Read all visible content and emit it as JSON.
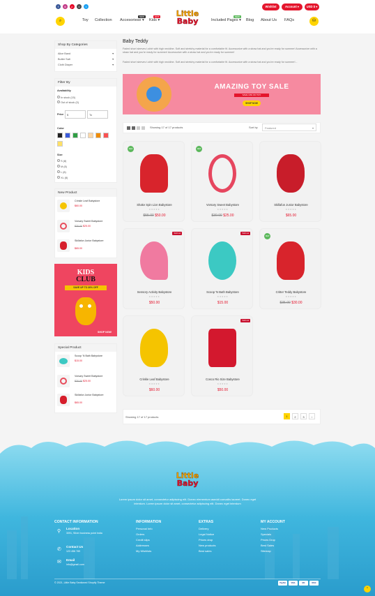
{
  "header": {
    "wishlist": "Wishlist",
    "account": "Account",
    "currency": "USD $",
    "nav": [
      "Toy",
      "Collection",
      "Accesoriese",
      "Kids",
      "Included Pages",
      "Blog",
      "About Us",
      "FAQs"
    ],
    "nav_badges": {
      "accessories": "NEW",
      "kids": "HOT",
      "pages": "NEW"
    },
    "logo_line1": "Little",
    "logo_line2": "Baby"
  },
  "sidebar": {
    "categories_title": "Shop By Categories",
    "categories": [
      "Alice Band",
      "Butter Salt",
      "Cloth Diaper"
    ],
    "filter_title": "Filter By",
    "availability_title": "Availability",
    "availability": [
      "In stock (15)",
      "Out of stock (0)"
    ],
    "price_title": "Price",
    "price_from": "$",
    "price_to": "To",
    "color_title": "Color",
    "colors": [
      "#222222",
      "#3b5bdb",
      "#2f9e44",
      "#ffffff",
      "#ffd8a8",
      "#f08c00",
      "#fa5252",
      "#ffe066"
    ],
    "size_title": "Size",
    "sizes": [
      "S (8)",
      "M (8)",
      "L (8)",
      "XL (8)"
    ],
    "new_title": "New Product",
    "new_products": [
      {
        "name": "Crinkle Leaf Babystore",
        "price": "$60.00",
        "old": ""
      },
      {
        "name": "Vorsary Sweet Babystore",
        "price": "$25.00",
        "old": "$30.00"
      },
      {
        "name": "Skillafun Junior Babystore",
        "price": "$65.00",
        "old": ""
      }
    ],
    "promo": {
      "line1": "KIDS",
      "line2": "CLUB",
      "offer": "SAVE UP TO 30% OFF",
      "button": "SHOP NOW"
    },
    "special_title": "Special Product",
    "special_products": [
      {
        "name": "Scoop 'N Bath Babystore",
        "price": "$15.00",
        "old": ""
      },
      {
        "name": "Vorsary Sweet Babystore",
        "price": "$25.00",
        "old": "$30.00"
      },
      {
        "name": "Skillafun Junior Babystore",
        "price": "$65.00",
        "old": ""
      }
    ]
  },
  "main": {
    "title": "Baby Teddy",
    "desc1": "Faded short sleeves t-shirt with high neckline. Soft and stretchy material for a comfortable fit. Accessorize with a straw hat and you're ready for summer! Accessorize with a straw hat and you're ready for summer! Accessorize with a straw hat and you're ready for summer!",
    "desc2": "Faded short sleeves t-shirt with high neckline. Soft and stretchy material for a comfortable fit. Accessorize with a straw hat and you're ready for summer!...",
    "banner": {
      "title": "AMAZING TOY SALE",
      "sub": "SAVE 10% ON TOY",
      "button": "SHOP NOW"
    },
    "showing": "Showing 17 of 17 products",
    "sort_label": "Sort by",
    "sort_value": "Featured",
    "products": [
      {
        "name": "Shake Spin Lion Babystore",
        "price": "$50.00",
        "old": "$55.00",
        "badge": "NEW",
        "sold": ""
      },
      {
        "name": "Vorsary Sweet Babystore",
        "price": "$25.00",
        "old": "$30.00",
        "badge": "NEW",
        "sold": ""
      },
      {
        "name": "Skillafun Junior Babystore",
        "price": "$65.00",
        "old": "",
        "badge": "",
        "sold": ""
      },
      {
        "name": "Sensory Activity Babystore",
        "price": "$50.00",
        "old": "",
        "badge": "",
        "sold": "Sold out"
      },
      {
        "name": "Scoop 'N Bath Babystore",
        "price": "$15.00",
        "old": "",
        "badge": "",
        "sold": "Sold out"
      },
      {
        "name": "Critter Teddy Babystore",
        "price": "$30.00",
        "old": "$35.00",
        "badge": "NEW",
        "sold": ""
      },
      {
        "name": "Crinkle Leaf Babystore",
        "price": "$60.00",
        "old": "",
        "badge": "",
        "sold": ""
      },
      {
        "name": "Cosco Rio Size Babystore",
        "price": "$50.00",
        "old": "",
        "badge": "",
        "sold": "Sold out"
      }
    ],
    "stars": "★★★★★",
    "pager_showing": "Showing 17 of 17 products",
    "pages": [
      "1",
      "2",
      "3",
      "›"
    ]
  },
  "footer": {
    "desc1": "Lorem ipsum dolor sit amet, consectetur adipiscing elit. Donec elementum aseddi convallis laoreet. Donec eget",
    "desc2": "interdum. Lorem ipsum dolor sit amet, consectetur adipiscing elit. Donec eget interdum",
    "contact_title": "CONTACT INFORMATION",
    "location_label": "Location",
    "location": "3091, Silver business point India",
    "contact_label": "Contact Us",
    "phone": "123 456 789",
    "email_label": "Email",
    "email": "info@gmail.com",
    "info_title": "INFORMATION",
    "info": [
      "Personal Info",
      "Orders",
      "Credit slips",
      "Addresses",
      "My Wishlists"
    ],
    "extras_title": "EXTRAS",
    "extras": [
      "Delivery",
      "Legal Notice",
      "Prices drop",
      "New products",
      "Best sales"
    ],
    "account_title": "MY ACCOUNT",
    "account": [
      "New Products",
      "Specials",
      "Prices Drop",
      "Best Sales",
      "Sitemap"
    ],
    "copyright": "© 2021, Little Baby Sectioned Shopify Theme",
    "payments": [
      "PayPal",
      "VISA",
      "MC",
      "DISC"
    ]
  }
}
